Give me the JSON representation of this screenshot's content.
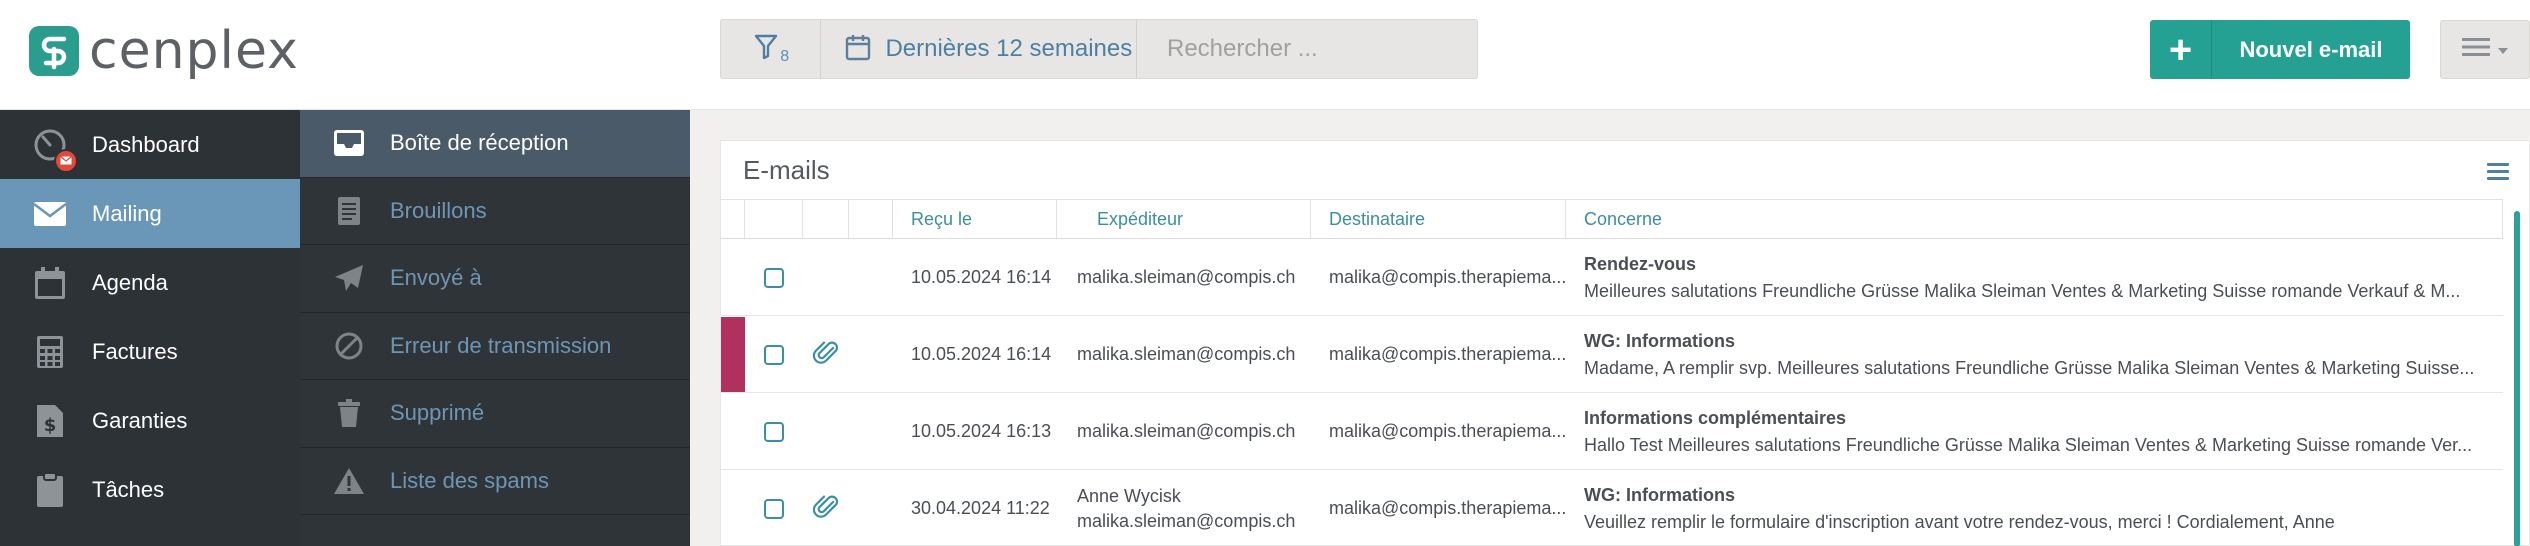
{
  "brand": {
    "name": "cenplex"
  },
  "filters": {
    "count": "8",
    "date_range": "Dernières 12 semaines",
    "search_placeholder": "Rechercher ..."
  },
  "actions": {
    "new_email_label": "Nouvel e-mail"
  },
  "sidebar": {
    "items": [
      {
        "label": "Dashboard",
        "icon": "dashboard-icon"
      },
      {
        "label": "Mailing",
        "icon": "envelope-icon",
        "active": true
      },
      {
        "label": "Agenda",
        "icon": "calendar-icon"
      },
      {
        "label": "Factures",
        "icon": "calculator-icon"
      },
      {
        "label": "Garanties",
        "icon": "dollar-file-icon"
      },
      {
        "label": "Tâches",
        "icon": "clipboard-icon"
      }
    ]
  },
  "subnav": {
    "items": [
      {
        "label": "Boîte de réception",
        "icon": "inbox-icon",
        "active": true
      },
      {
        "label": "Brouillons",
        "icon": "draft-icon"
      },
      {
        "label": "Envoyé à",
        "icon": "paper-plane-icon"
      },
      {
        "label": "Erreur de transmission",
        "icon": "ban-icon"
      },
      {
        "label": "Supprimé",
        "icon": "trash-icon"
      },
      {
        "label": "Liste des spams",
        "icon": "warning-icon"
      }
    ]
  },
  "emails": {
    "title": "E-mails",
    "columns": {
      "received": "Reçu le",
      "sender": "Expéditeur",
      "recipient": "Destinataire",
      "subject": "Concerne"
    },
    "rows": [
      {
        "flagged": false,
        "attachment": false,
        "received": "10.05.2024 16:14",
        "sender_name": "",
        "sender": "malika.sleiman@compis.ch",
        "recipient": "malika@compis.therapiema...",
        "subject": "Rendez-vous",
        "preview": "   Meilleures salutations Freundliche Grüsse Malika Sleiman  Ventes & Marketing Suisse romande Verkauf & M..."
      },
      {
        "flagged": true,
        "attachment": true,
        "received": "10.05.2024 16:14",
        "sender_name": "",
        "sender": "malika.sleiman@compis.ch",
        "recipient": "malika@compis.therapiema...",
        "subject": "WG: Informations",
        "preview": "Madame,  A remplir svp.  Meilleures salutations Freundliche Grüsse Malika Sleiman  Ventes & Marketing Suisse..."
      },
      {
        "flagged": false,
        "attachment": false,
        "received": "10.05.2024 16:13",
        "sender_name": "",
        "sender": "malika.sleiman@compis.ch",
        "recipient": "malika@compis.therapiema...",
        "subject": "Informations complémentaires",
        "preview": "Hallo  Test    Meilleures salutations Freundliche Grüsse Malika Sleiman  Ventes & Marketing Suisse romande Ver..."
      },
      {
        "flagged": false,
        "attachment": true,
        "received": "30.04.2024 11:22",
        "sender_name": "Anne Wycisk",
        "sender": "malika.sleiman@compis.ch",
        "recipient": "malika@compis.therapiema...",
        "subject": "WG: Informations",
        "preview": "Veuillez remplir le formulaire d'inscription avant votre rendez-vous, merci ! Cordialement,  Anne"
      }
    ]
  },
  "colors": {
    "accent": "#24a193",
    "sidebar_bg": "#2d3237",
    "sidebar_active": "#6a96b8",
    "link": "#4e7fa3",
    "flag": "#b0305e"
  }
}
